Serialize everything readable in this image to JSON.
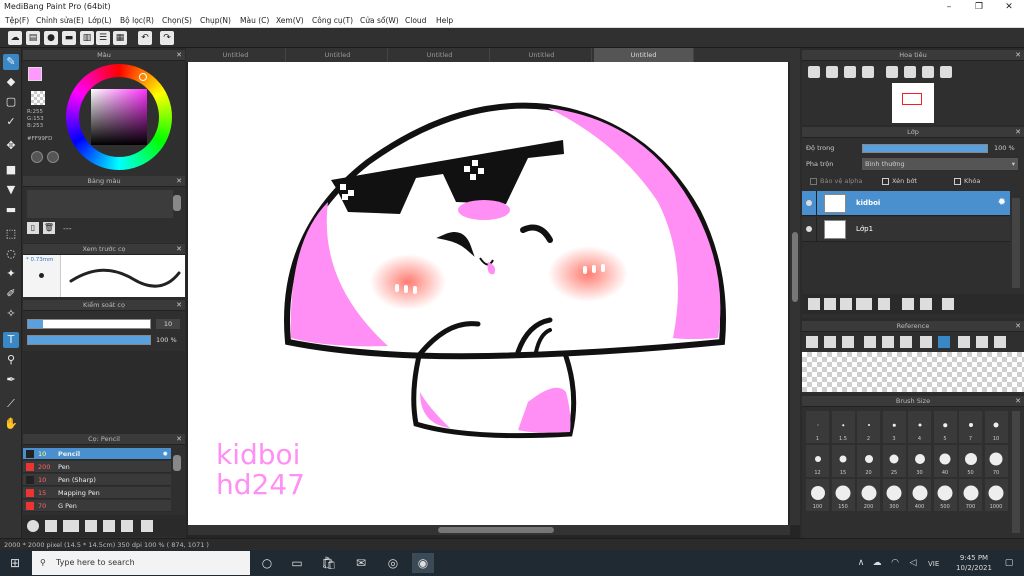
{
  "window": {
    "title": "MediBang Paint Pro (64bit)",
    "minimize": "–",
    "maximize": "❐",
    "close": "✕"
  },
  "menu": [
    "Tệp(F)",
    "Chỉnh sửa(E)",
    "Lớp(L)",
    "Bộ lọc(R)",
    "Chọn(S)",
    "Chụp(N)",
    "Màu (C)",
    "Xem(V)",
    "Công cụ(T)",
    "Cửa sổ(W)",
    "Cloud",
    "Help"
  ],
  "tabs": [
    "Untitled",
    "Untitled",
    "Untitled",
    "Untitled",
    "Untitled"
  ],
  "color_panel": {
    "title": "Màu",
    "r": "R:255",
    "g": "G:153",
    "b": "B:253",
    "hex": "#FF99FD",
    "fg_color": "#ff99fd"
  },
  "palette_panel": {
    "title": "Bảng màu",
    "dash": "---"
  },
  "brush_preview": {
    "title": "Xem trước cọ",
    "size": "0.73mm"
  },
  "brush_control": {
    "title": "Kiểm soát cọ",
    "size_value": "10",
    "size_fill": 0.12,
    "opacity_value": "100 %",
    "opacity_fill": 1.0
  },
  "brush_list": {
    "title": "Cọ: Pencil",
    "items": [
      {
        "size": "10",
        "name": "Pencil",
        "active": true
      },
      {
        "size": "200",
        "name": "Pen",
        "active": false
      },
      {
        "size": "10",
        "name": "Pen (Sharp)",
        "active": false
      },
      {
        "size": "15",
        "name": "Mapping Pen",
        "active": false
      },
      {
        "size": "70",
        "name": "G Pen",
        "active": false
      }
    ]
  },
  "artwork": {
    "watermark_line1": "kidboi",
    "watermark_line2": "hd247",
    "pink": "#ff8ff5"
  },
  "navigator": {
    "title": "Hoa tiêu"
  },
  "layer_panel": {
    "title": "Lớp",
    "opacity_label": "Độ trong",
    "opacity_value": "100 %",
    "opacity_fill": 1.0,
    "blend_label": "Pha trộn",
    "blend_value": "Bình thường",
    "alpha_lock": "Bảo vệ alpha",
    "clipping": "Xén bớt",
    "lock": "Khóa",
    "layers": [
      {
        "name": "kidboi",
        "active": true
      },
      {
        "name": "Lớp1",
        "active": false
      }
    ]
  },
  "reference": {
    "title": "Reference"
  },
  "brush_size": {
    "title": "Brush Size",
    "sizes": [
      "1",
      "1.5",
      "2",
      "3",
      "4",
      "5",
      "7",
      "10",
      "12",
      "15",
      "20",
      "25",
      "30",
      "40",
      "50",
      "70",
      "100",
      "150",
      "200",
      "300",
      "400",
      "500",
      "700",
      "1000"
    ]
  },
  "status": "2000 * 2000 pixel   (14.5 * 14.5cm)   350 dpi   100 %   ( 874, 1071 )",
  "taskbar": {
    "search_placeholder": "Type here to search",
    "time": "9:45 PM",
    "date": "10/2/2021",
    "lang": "VIE"
  }
}
